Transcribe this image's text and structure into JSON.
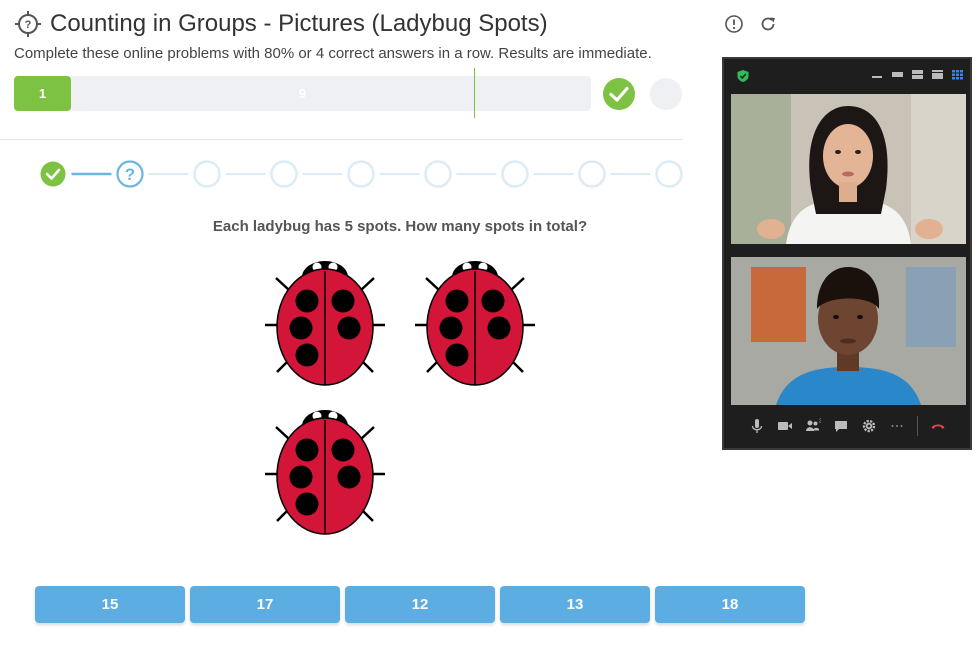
{
  "header": {
    "title": "Counting in Groups - Pictures (Ladybug Spots)",
    "subtitle": "Complete these online problems with 80% or 4 correct answers in a row. Results are immediate.",
    "info_icon": "info-circle-icon",
    "refresh_icon": "refresh-icon",
    "title_icon": "target-question-icon"
  },
  "progress": {
    "correct_label": "1",
    "total_label": "9",
    "correct_fraction": 0.099,
    "target_fraction": 0.8
  },
  "steps": {
    "states": [
      "done",
      "current",
      "pending",
      "pending",
      "pending",
      "pending",
      "pending",
      "pending",
      "pending"
    ]
  },
  "question": {
    "text": "Each ladybug has 5 spots. How many spots in total?",
    "ladybug_count": 3,
    "spots_per_ladybug": 5
  },
  "answers": [
    "15",
    "17",
    "12",
    "13",
    "18"
  ],
  "video_call": {
    "participants": [
      "participant-1",
      "participant-2"
    ],
    "controls": [
      "microphone-icon",
      "camera-icon",
      "participants-icon",
      "chat-icon",
      "settings-icon",
      "more-icon",
      "hang-up-icon"
    ],
    "participants_count_badge": "2"
  },
  "colors": {
    "accent_green": "#7dc242",
    "answer_blue": "#5caee2",
    "step_blue": "#6bb6e0",
    "ladybug_red": "#d21538"
  }
}
